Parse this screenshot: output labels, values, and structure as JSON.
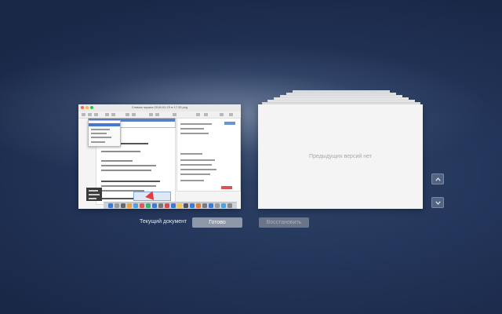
{
  "current_document": {
    "caption": "Текущий документ",
    "thumbnail_title": "Снимок экрана 2018-01-23 в 17.33.png"
  },
  "previous_versions": {
    "empty_text": "Предыдущих версий нет"
  },
  "buttons": {
    "done": "Готово",
    "restore": "Восстановить"
  },
  "navigation": {
    "up_icon": "chevron-up-icon",
    "down_icon": "chevron-down-icon"
  },
  "colors": {
    "background": "#23355a",
    "done_button": "#8d97a8",
    "restore_button_disabled": "#6a7588"
  }
}
